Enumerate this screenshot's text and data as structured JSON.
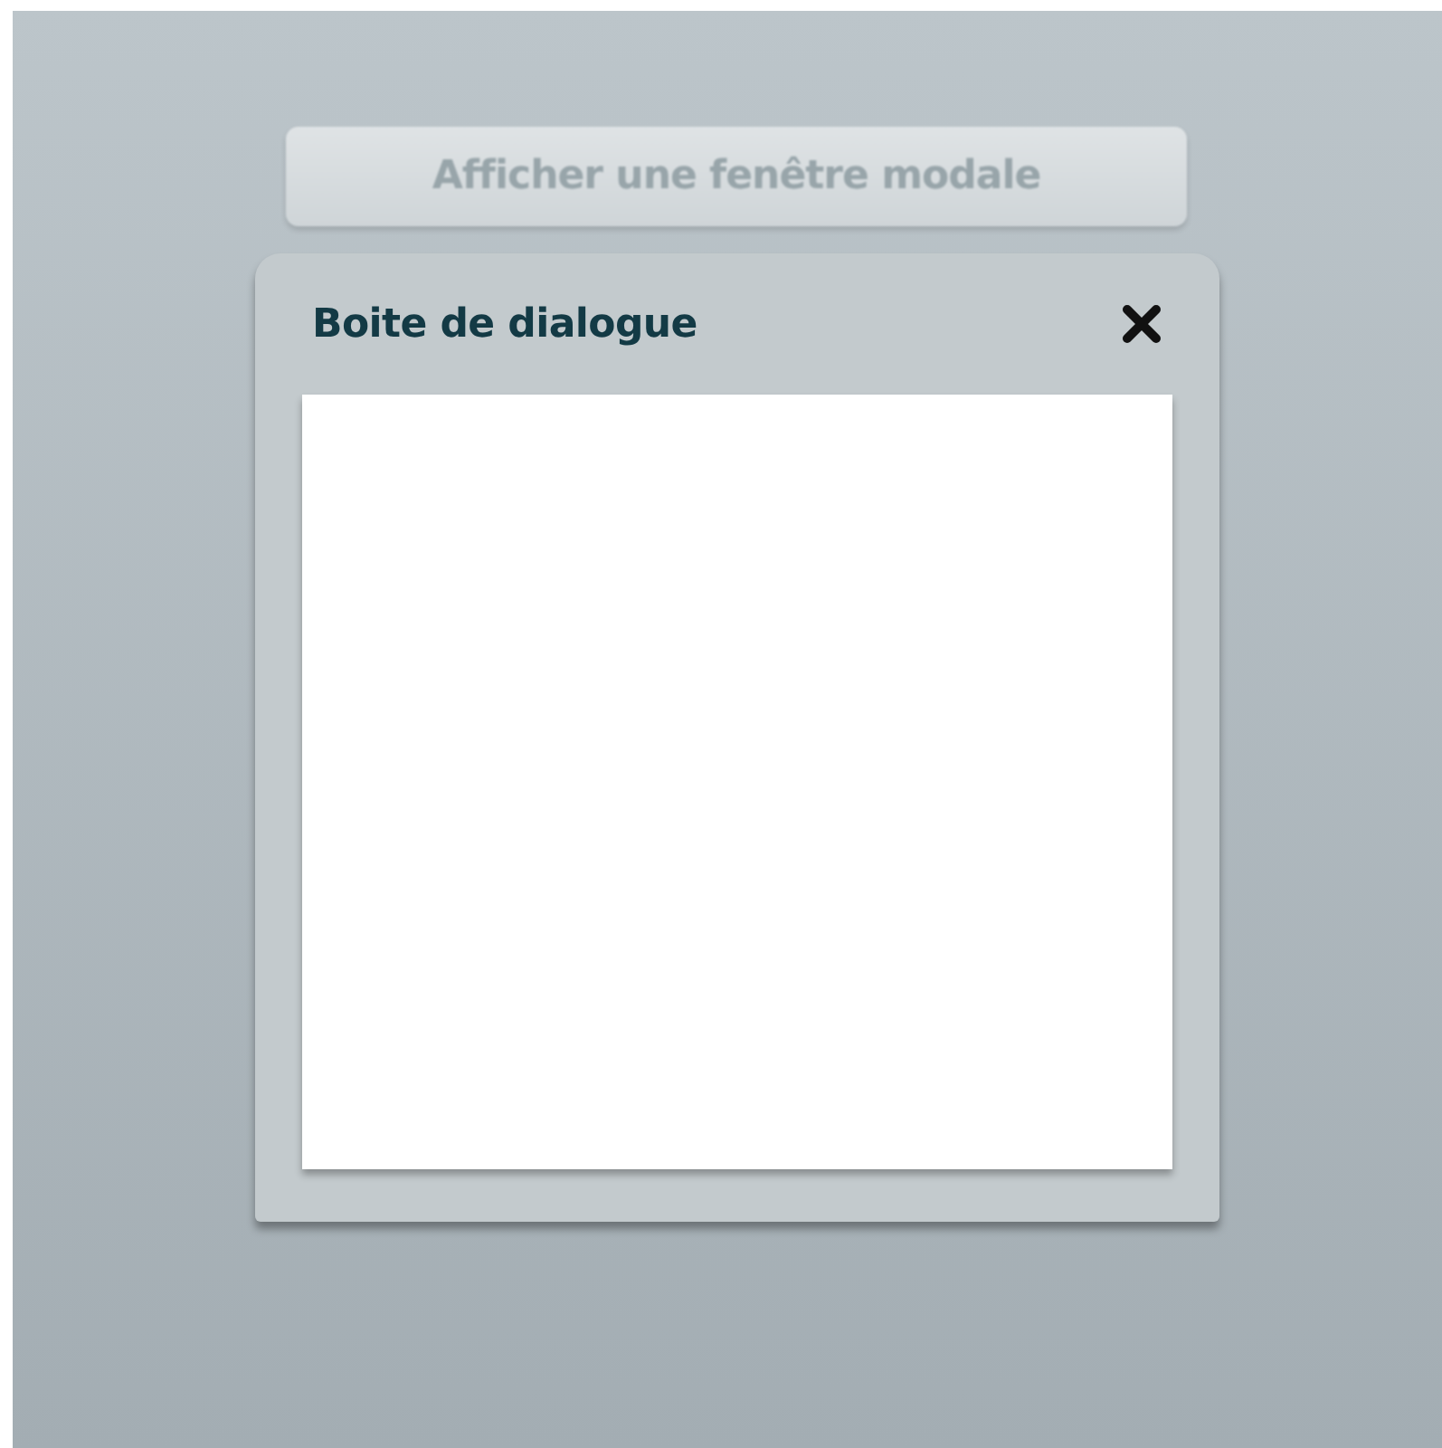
{
  "button": {
    "label": "Afficher une fenêtre modale",
    "disabled": true
  },
  "dialog": {
    "title": "Boite de dialogue"
  }
}
